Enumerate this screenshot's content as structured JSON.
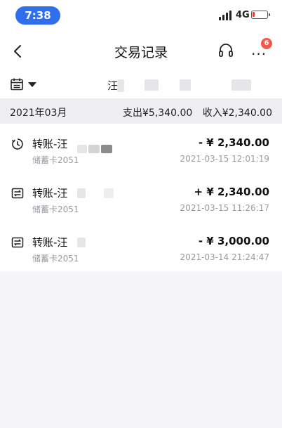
{
  "status": {
    "time": "7:38",
    "network": "4G",
    "battery_level": 0.15,
    "battery_color": "#e23b3b"
  },
  "nav": {
    "title": "交易记录",
    "badge_count": "6"
  },
  "filter": {
    "account_name": "汪"
  },
  "summary": {
    "month": "2021年03月",
    "expense": "支出¥5,340.00",
    "income": "收入¥2,340.00"
  },
  "transactions": [
    {
      "name": "转账-汪",
      "card": "储蓄卡2051",
      "amount": "- ¥ 2,340.00",
      "time": "2021-03-15 12:01:19",
      "icon": "clock-transfer-icon"
    },
    {
      "name": "转账-汪",
      "card": "储蓄卡2051",
      "amount": "+ ¥ 2,340.00",
      "time": "2021-03-15 11:26:17",
      "icon": "transfer-icon"
    },
    {
      "name": "转账-汪",
      "card": "储蓄卡2051",
      "amount": "- ¥ 3,000.00",
      "time": "2021-03-14 21:24:47",
      "icon": "transfer-icon"
    }
  ],
  "colors": {
    "accent": "#2f6fed",
    "badge": "#f05a4a",
    "secondary_text": "#9a9aa0"
  }
}
